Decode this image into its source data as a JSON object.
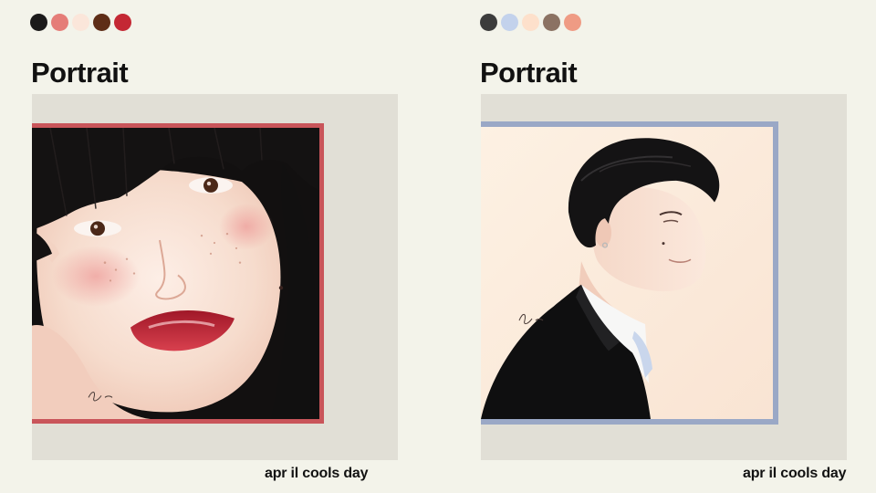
{
  "panels": [
    {
      "title": "Portrait",
      "palette": [
        "#1b1a1a",
        "#e57d78",
        "#fbe6da",
        "#5e2d17",
        "#c42834"
      ],
      "frame_color": "#c9555a",
      "footer": "apr il cools day"
    },
    {
      "title": "Portrait",
      "palette": [
        "#3c3c3c",
        "#c3d2ec",
        "#fde0cb",
        "#8b7263",
        "#ef9b84"
      ],
      "frame_color": "#9aa8c6",
      "footer": "apr il cools day"
    }
  ]
}
